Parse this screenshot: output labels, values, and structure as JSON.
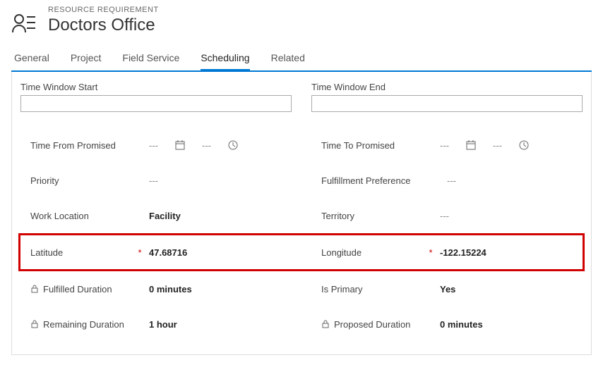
{
  "header": {
    "subtitle": "RESOURCE REQUIREMENT",
    "title": "Doctors Office"
  },
  "tabs": {
    "items": [
      "General",
      "Project",
      "Field Service",
      "Scheduling",
      "Related"
    ],
    "active": "Scheduling"
  },
  "sections": {
    "left": {
      "label": "Time Window Start",
      "value": ""
    },
    "right": {
      "label": "Time Window End",
      "value": ""
    }
  },
  "left_fields": {
    "time_from": {
      "label": "Time From Promised",
      "date": "---",
      "time": "---"
    },
    "priority": {
      "label": "Priority",
      "value": "---"
    },
    "work_location": {
      "label": "Work Location",
      "value": "Facility"
    },
    "latitude": {
      "label": "Latitude",
      "value": "47.68716"
    },
    "fulfilled": {
      "label": "Fulfilled Duration",
      "value": "0 minutes"
    },
    "remaining": {
      "label": "Remaining Duration",
      "value": "1 hour"
    }
  },
  "right_fields": {
    "time_to": {
      "label": "Time To Promised",
      "date": "---",
      "time": "---"
    },
    "fulfillment": {
      "label": "Fulfillment Preference",
      "value": "---"
    },
    "territory": {
      "label": "Territory",
      "value": "---"
    },
    "longitude": {
      "label": "Longitude",
      "value": "-122.15224"
    },
    "is_primary": {
      "label": "Is Primary",
      "value": "Yes"
    },
    "proposed": {
      "label": "Proposed Duration",
      "value": "0 minutes"
    }
  },
  "symbols": {
    "required": "*"
  }
}
